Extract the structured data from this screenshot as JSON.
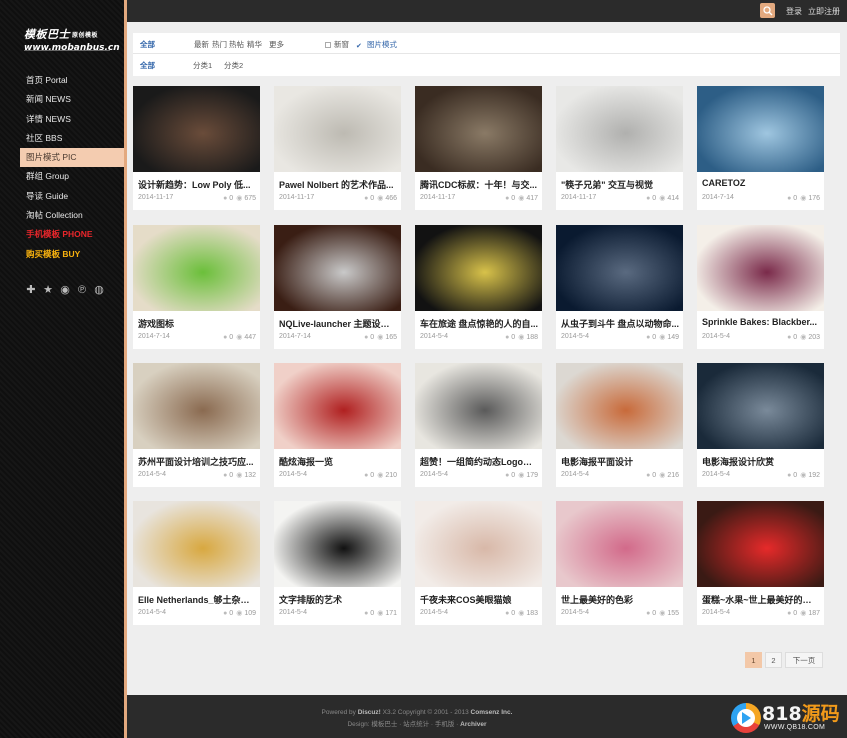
{
  "logo": {
    "name": "模板巴士",
    "sub": "原创模板",
    "url": "www.mobanbus.cn"
  },
  "nav": [
    {
      "label": "首页 Portal",
      "style": "normal"
    },
    {
      "label": "新闻 NEWS",
      "style": "normal"
    },
    {
      "label": "详情 NEWS",
      "style": "normal"
    },
    {
      "label": "社区 BBS",
      "style": "normal"
    },
    {
      "label": "图片模式 PIC",
      "style": "active"
    },
    {
      "label": "群组 Group",
      "style": "normal"
    },
    {
      "label": "导读 Guide",
      "style": "normal"
    },
    {
      "label": "淘帖 Collection",
      "style": "normal"
    },
    {
      "label": "手机模板 PHONE",
      "style": "red"
    },
    {
      "label": "购买模板 BUY",
      "style": "orange"
    }
  ],
  "social_icons": [
    "plus-icon",
    "star-icon",
    "weibo-icon",
    "tencent-weibo-icon",
    "wechat-icon"
  ],
  "topbar": {
    "login": "登录",
    "register": "立即注册"
  },
  "filter": {
    "row1": {
      "all": "全部",
      "latest": "最新",
      "hot": "热门",
      "hot_posts": "热帖",
      "digest": "精华",
      "more": "更多",
      "new_window": "新窗",
      "pic_mode": "图片模式"
    },
    "row2": {
      "all": "全部",
      "cat1": "分类1",
      "cat2": "分类2"
    }
  },
  "thumb_colors": [
    [
      "#1a1a1a",
      "#6a4c3a"
    ],
    [
      "#e9e7e2",
      "#bdbab2"
    ],
    [
      "#3a2c22",
      "#8a7a66"
    ],
    [
      "#e8e8e6",
      "#b0b0ae"
    ],
    [
      "#2d5e86",
      "#9fc6e0"
    ],
    [
      "#e5dcc8",
      "#6bbf3a"
    ],
    [
      "#3a1e14",
      "#c9c9c9"
    ],
    [
      "#121212",
      "#d8c24a"
    ],
    [
      "#0a1a30",
      "#5a6a80"
    ],
    [
      "#f4efe8",
      "#7a2a4a"
    ],
    [
      "#d8d0c0",
      "#8a6a50"
    ],
    [
      "#f0d0c8",
      "#b02020"
    ],
    [
      "#e8e6e0",
      "#5a5a5a"
    ],
    [
      "#dcd8d2",
      "#c86a3a"
    ],
    [
      "#1a2a3a",
      "#7a8a9a"
    ],
    [
      "#e8e4de",
      "#d8a840"
    ],
    [
      "#f4f4f2",
      "#111111"
    ],
    [
      "#f2ece8",
      "#d8b8a8"
    ],
    [
      "#e8c8cc",
      "#d26a8a"
    ],
    [
      "#3a1a14",
      "#e62a2a"
    ]
  ],
  "posts": [
    {
      "title": "设计新趋势：Low Poly 低...",
      "date": "2014-11-17",
      "replies": "0",
      "views": "675"
    },
    {
      "title": "Pawel Nolbert 的艺术作品...",
      "date": "2014-11-17",
      "replies": "0",
      "views": "466"
    },
    {
      "title": "腾讯CDC标叔：十年！与交...",
      "date": "2014-11-17",
      "replies": "0",
      "views": "417"
    },
    {
      "title": "\"筷子兄弟\" 交互与视觉",
      "date": "2014-11-17",
      "replies": "0",
      "views": "414"
    },
    {
      "title": "CARETOZ",
      "date": "2014-7-14",
      "replies": "0",
      "views": "176"
    },
    {
      "title": "游戏图标",
      "date": "2014-7-14",
      "replies": "0",
      "views": "447"
    },
    {
      "title": "NQLive-launcher 主题设计...",
      "date": "2014-7-14",
      "replies": "0",
      "views": "165"
    },
    {
      "title": "车在旅途 盘点惊艳的人的自...",
      "date": "2014-5-4",
      "replies": "0",
      "views": "188"
    },
    {
      "title": "从虫子到斗牛 盘点以动物命...",
      "date": "2014-5-4",
      "replies": "0",
      "views": "149"
    },
    {
      "title": "Sprinkle Bakes: Blackber...",
      "date": "2014-5-4",
      "replies": "0",
      "views": "203"
    },
    {
      "title": "苏州平面设计培训之技巧应...",
      "date": "2014-5-4",
      "replies": "0",
      "views": "132"
    },
    {
      "title": "酷炫海报一览",
      "date": "2014-5-4",
      "replies": "0",
      "views": "210"
    },
    {
      "title": "超赞！一组简约动态Logo设计",
      "date": "2014-5-4",
      "replies": "0",
      "views": "179"
    },
    {
      "title": "电影海报平面设计",
      "date": "2014-5-4",
      "replies": "0",
      "views": "216"
    },
    {
      "title": "电影海报设计欣赏",
      "date": "2014-5-4",
      "replies": "0",
      "views": "192"
    },
    {
      "title": "Elle Netherlands_够土杂志...",
      "date": "2014-5-4",
      "replies": "0",
      "views": "109"
    },
    {
      "title": "文字排版的艺术",
      "date": "2014-5-4",
      "replies": "0",
      "views": "171"
    },
    {
      "title": "千夜未来COS美眼猫娘",
      "date": "2014-5-4",
      "replies": "0",
      "views": "183"
    },
    {
      "title": "世上最美好的色彩",
      "date": "2014-5-4",
      "replies": "0",
      "views": "155"
    },
    {
      "title": "蛋糕~水果~世上最美好的色彩",
      "date": "2014-5-4",
      "replies": "0",
      "views": "187"
    }
  ],
  "pagination": {
    "p1": "1",
    "p2": "2",
    "next": "下一页"
  },
  "footer": {
    "powered": "Powered by",
    "discuz": "Discuz!",
    "version": "X3.2 Copyright © 2001 - 2013",
    "company": "Comsenz Inc.",
    "design": "Design:",
    "designer": "模板巴士",
    "links": "· 站点统计 · 手机版 ·",
    "archiver": "Archiver"
  },
  "watermark": {
    "num_white": "818",
    "num_orange": "源码",
    "url": "WWW.QB18.COM"
  }
}
